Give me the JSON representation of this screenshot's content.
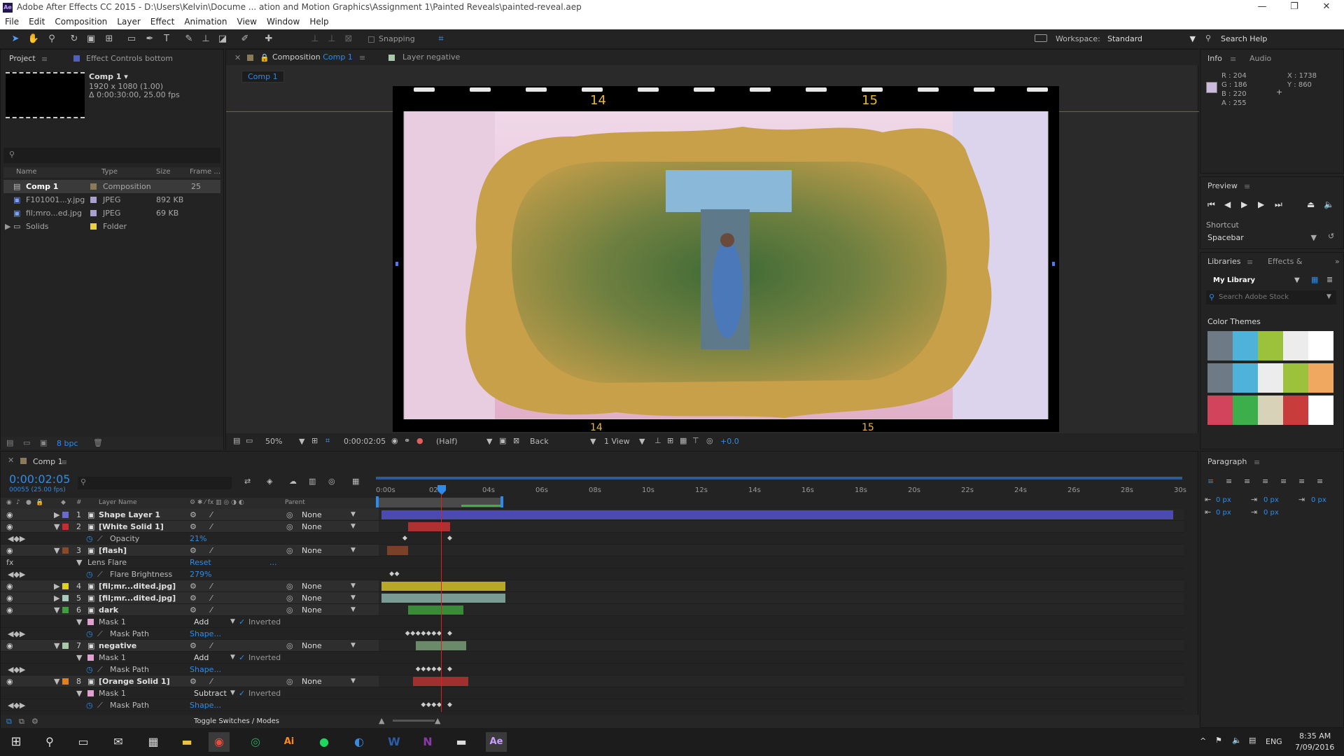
{
  "title_bar": {
    "app_icon": "Ae",
    "title": "Adobe After Effects CC 2015 - D:\\Users\\Kelvin\\Docume ... ation and Motion Graphics\\Assignment 1\\Painted Reveals\\painted-reveal.aep",
    "minimize": "—",
    "restore": "❐",
    "close": "✕"
  },
  "menu": [
    "File",
    "Edit",
    "Composition",
    "Layer",
    "Effect",
    "Animation",
    "View",
    "Window",
    "Help"
  ],
  "toolbar": {
    "snapping_label": "Snapping",
    "workspace_label": "Workspace:",
    "workspace_value": "Standard",
    "search_help": "Search Help"
  },
  "project": {
    "tab_project": "Project",
    "tab_effect_controls": "Effect Controls bottom",
    "comp_name": "Comp 1 ▾",
    "comp_res": "1920 x 1080 (1.00)",
    "comp_dur": "Δ 0:00:30:00, 25.00 fps",
    "search_placeholder": "",
    "columns": [
      "Name",
      "Type",
      "Size",
      "Frame ..."
    ],
    "items": [
      {
        "name": "Comp 1",
        "type": "Composition",
        "size": "",
        "frame": "25",
        "color": "#8a7a5a"
      },
      {
        "name": "F101001...y.jpg",
        "type": "JPEG",
        "size": "892 KB",
        "frame": "",
        "color": "#a9a0d0"
      },
      {
        "name": "fil;mro...ed.jpg",
        "type": "JPEG",
        "size": "69 KB",
        "frame": "",
        "color": "#a9a0d0"
      },
      {
        "name": "Solids",
        "type": "Folder",
        "size": "",
        "frame": "",
        "color": "#e8d040"
      }
    ],
    "bpc": "8 bpc"
  },
  "composition": {
    "tab_label": "Composition",
    "tab_comp": "Comp 1",
    "tab_layer": "Layer negative",
    "comp_chip": "Comp 1",
    "film_num_left": "14",
    "film_num_right": "15",
    "film_num_left_bottom": "14",
    "film_num_right_bottom": "15",
    "zoom": "50%",
    "timecode": "0:00:02:05",
    "resolution": "(Half)",
    "camera": "Back",
    "views": "1 View",
    "exposure": "+0.0"
  },
  "info": {
    "tab_info": "Info",
    "tab_audio": "Audio",
    "r": "R : 204",
    "g": "G : 186",
    "b": "B : 220",
    "a": "A : 255",
    "x": "X : 1738",
    "y": "Y : 860",
    "swatch_color": "#ccbadc"
  },
  "preview": {
    "title": "Preview",
    "shortcut_label": "Shortcut",
    "shortcut_value": "Spacebar"
  },
  "libraries": {
    "tab_libraries": "Libraries",
    "tab_effects": "Effects & Pre:",
    "library": "My Library",
    "search_placeholder": "Search Adobe Stock",
    "color_themes": "Color Themes",
    "themes": [
      [
        "#6e7a86",
        "#4fb3d9",
        "#9cc23c",
        "#ececec",
        "#ffffff"
      ],
      [
        "#6e7a86",
        "#4fb3d9",
        "#ececec",
        "#9cc23c",
        "#f0a860"
      ],
      [
        "#d2445c",
        "#3cae4c",
        "#d8d2b8",
        "#c83c3c",
        "#ffffff"
      ]
    ]
  },
  "paragraph": {
    "title": "Paragraph",
    "v1": "0 px",
    "v2": "0 px",
    "v3": "0 px",
    "v4": "0 px",
    "v5": "0 px"
  },
  "timeline": {
    "tab": "Comp 1",
    "timecode": "0:00:02:05",
    "frames": "00055 (25.00 fps)",
    "col_layer_name": "Layer Name",
    "col_parent": "Parent",
    "ruler": [
      "0:00s",
      "02s",
      "04s",
      "06s",
      "08s",
      "10s",
      "12s",
      "14s",
      "16s",
      "18s",
      "20s",
      "22s",
      "24s",
      "26s",
      "28s",
      "30s"
    ],
    "toggle_label": "Toggle Switches / Modes",
    "rows": [
      {
        "num": "1",
        "name": "Shape Layer 1",
        "label": "#6a6ad0",
        "parent": "None",
        "kind": "layer"
      },
      {
        "num": "2",
        "name": "[White Solid 1]",
        "label": "#c03030",
        "parent": "None",
        "kind": "layer"
      },
      {
        "num": "",
        "name": "Opacity",
        "value": "21%",
        "kind": "prop"
      },
      {
        "num": "3",
        "name": "[flash]",
        "label": "#8a4a2a",
        "parent": "None",
        "kind": "layer"
      },
      {
        "num": "",
        "name": "Lens Flare",
        "value": "Reset",
        "extra": "...",
        "kind": "effect"
      },
      {
        "num": "",
        "name": "Flare Brightness",
        "value": "279%",
        "kind": "prop"
      },
      {
        "num": "4",
        "name": "[fil;mr...dited.jpg]",
        "label": "#e0d020",
        "parent": "None",
        "kind": "layer"
      },
      {
        "num": "5",
        "name": "[fil;mr...dited.jpg]",
        "label": "#a8c8c0",
        "parent": "None",
        "kind": "layer"
      },
      {
        "num": "6",
        "name": "dark",
        "label": "#40a040",
        "parent": "None",
        "kind": "layer"
      },
      {
        "num": "",
        "name": "Mask 1",
        "mode": "Add",
        "inverted": "Inverted",
        "kind": "mask"
      },
      {
        "num": "",
        "name": "Mask Path",
        "value": "Shape...",
        "kind": "prop"
      },
      {
        "num": "7",
        "name": "negative",
        "label": "#a8c8a8",
        "parent": "None",
        "kind": "layer"
      },
      {
        "num": "",
        "name": "Mask 1",
        "mode": "Add",
        "inverted": "Inverted",
        "kind": "mask"
      },
      {
        "num": "",
        "name": "Mask Path",
        "value": "Shape...",
        "kind": "prop"
      },
      {
        "num": "8",
        "name": "[Orange Solid 1]",
        "label": "#e08020",
        "parent": "None",
        "kind": "layer"
      },
      {
        "num": "",
        "name": "Mask 1",
        "mode": "Subtract",
        "inverted": "Inverted",
        "kind": "mask"
      },
      {
        "num": "",
        "name": "Mask Path",
        "value": "Shape...",
        "kind": "prop"
      }
    ]
  },
  "taskbar": {
    "time": "8:35 AM",
    "date": "7/09/2016",
    "lang": "ENG"
  }
}
